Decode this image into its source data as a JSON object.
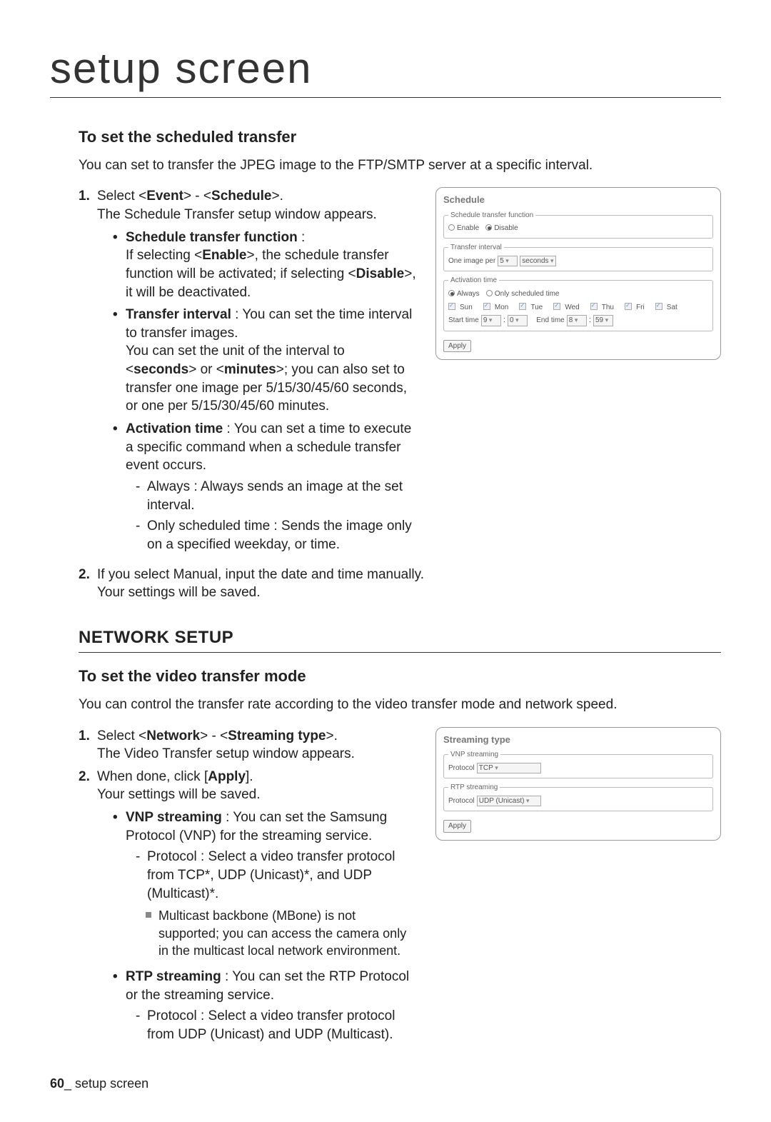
{
  "page_title": "setup screen",
  "sec1": {
    "heading": "To set the scheduled transfer",
    "intro": "You can set to transfer the JPEG image to the FTP/SMTP server at a specific interval.",
    "step1_pre": "Select <",
    "step1_b1": "Event",
    "step1_mid": "> - <",
    "step1_b2": "Schedule",
    "step1_post": ">.",
    "step1_line2": "The Schedule Transfer setup window appears.",
    "bullet1_label": "Schedule transfer function",
    "bullet1_colon": " : ",
    "bullet1_l2a": "If selecting <",
    "bullet1_b1": "Enable",
    "bullet1_l2b": ">, the schedule transfer function will be activated; if selecting <",
    "bullet1_b2": "Disable",
    "bullet1_l2c": ">, it will be deactivated.",
    "bullet2_label": "Transfer interval",
    "bullet2_rest_a": " : You can set the time interval to transfer images.",
    "bullet2_p2a": "You can set the unit of the interval to <",
    "bullet2_b1": "seconds",
    "bullet2_p2b": "> or <",
    "bullet2_b2": "minutes",
    "bullet2_p2c": ">; you can also set to transfer one image per 5/15/30/45/60 seconds, or one per 5/15/30/45/60 minutes.",
    "bullet3_label": "Activation time",
    "bullet3_rest": " : You can set a time to execute a specific command when a schedule transfer event occurs.",
    "bullet3_d1": "Always : Always sends an image at the set interval.",
    "bullet3_d2": "Only scheduled time : Sends the image only on a specified weekday, or time.",
    "step2_a": "If you select Manual, input the date and time manually.",
    "step2_b": "Your settings will be saved."
  },
  "panel1": {
    "title": "Schedule",
    "fs1_legend": "Schedule transfer function",
    "enable": "Enable",
    "disable": "Disable",
    "fs2_legend": "Transfer interval",
    "fs2_text_a": "One image per",
    "fs2_sel1": "5",
    "fs2_sel2": "seconds",
    "fs3_legend": "Activation time",
    "always": "Always",
    "only": "Only scheduled time",
    "days": {
      "sun": "Sun",
      "mon": "Mon",
      "tue": "Tue",
      "wed": "Wed",
      "thu": "Thu",
      "fri": "Fri",
      "sat": "Sat"
    },
    "start_label": "Start time",
    "start_h": "9",
    "start_m": "0",
    "end_label": "End time",
    "end_h": "8",
    "end_m": "59",
    "apply": "Apply"
  },
  "sec2_heading": "NETWORK SETUP",
  "sec3": {
    "heading": "To set the video transfer mode",
    "intro": "You can control the transfer rate according to the video transfer mode and network speed.",
    "step1_pre": "Select <",
    "step1_b1": "Network",
    "step1_mid": "> - <",
    "step1_b2": "Streaming type",
    "step1_post": ">.",
    "step1_l2": "The Video Transfer setup window appears.",
    "step2_a": "When done, click [",
    "step2_b": "Apply",
    "step2_c": "].",
    "step2_l2": "Your settings will be saved.",
    "bullet1_label": "VNP streaming",
    "bullet1_rest": " : You can set the Samsung Protocol (VNP) for the streaming service.",
    "bullet1_d1": "Protocol : Select a video transfer protocol from TCP*, UDP (Unicast)*, and UDP (Multicast)*.",
    "bullet1_note": "Multicast backbone (MBone) is not supported; you can access the camera only in the multicast local network environment.",
    "bullet2_label": "RTP streaming",
    "bullet2_rest": " : You can set the RTP Protocol or the streaming service.",
    "bullet2_d1": "Protocol : Select a video transfer protocol from UDP (Unicast) and UDP (Multicast)."
  },
  "panel2": {
    "title": "Streaming type",
    "fs1_legend": "VNP streaming",
    "proto_label": "Protocol",
    "vnp_val": "TCP",
    "fs2_legend": "RTP streaming",
    "rtp_val": "UDP (Unicast)",
    "apply": "Apply"
  },
  "footer_num": "60",
  "footer_sep": "_ ",
  "footer_text": "setup screen"
}
